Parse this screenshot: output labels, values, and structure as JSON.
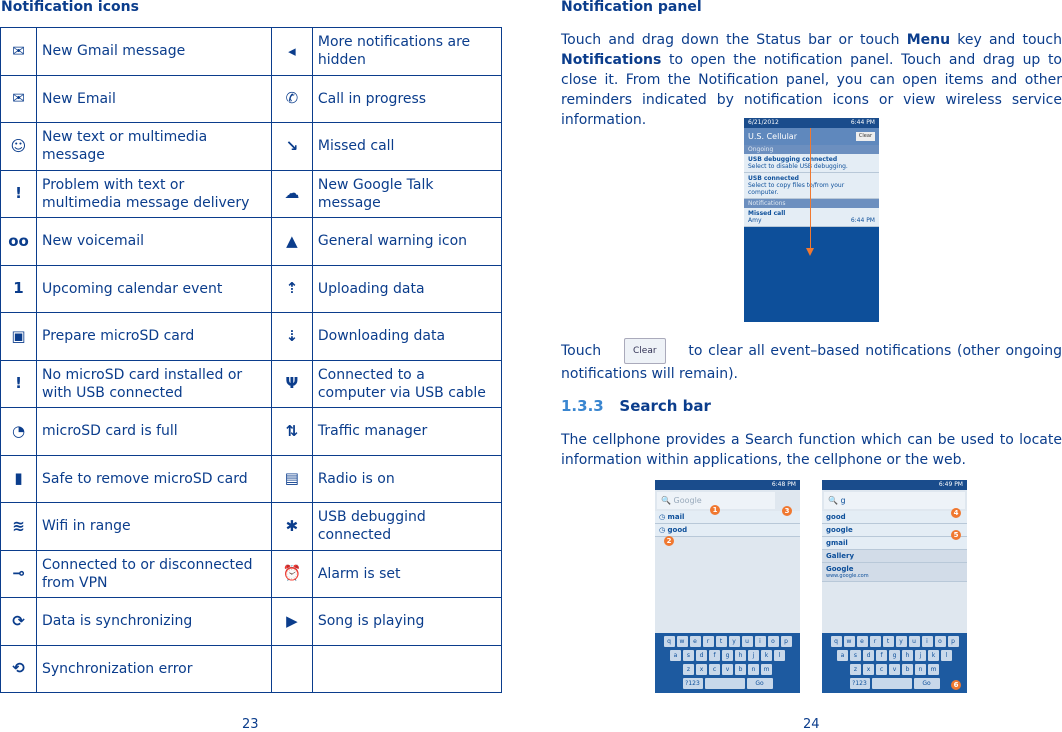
{
  "left": {
    "title": "Notification icons",
    "page": "23",
    "rows": [
      [
        "mail-icon",
        "New Gmail message",
        "hidden-notifications-icon",
        "More notifications are hidden"
      ],
      [
        "envelope-icon",
        "New Email",
        "phone-icon",
        "Call in progress"
      ],
      [
        "sms-icon",
        "New text or multimedia message",
        "missed-call-icon",
        "Missed call"
      ],
      [
        "sms-error-icon",
        "Problem with text or multimedia message delivery",
        "talk-icon",
        "New Google Talk message"
      ],
      [
        "voicemail-icon",
        "New voicemail",
        "warning-icon",
        "General warning icon"
      ],
      [
        "calendar-icon",
        "Upcoming calendar event",
        "upload-icon",
        "Uploading data"
      ],
      [
        "sd-prepare-icon",
        "Prepare microSD card",
        "download-icon",
        "Downloading data"
      ],
      [
        "sd-missing-icon",
        "No microSD card installed or with USB connected",
        "usb-icon",
        "Connected to a computer via USB cable"
      ],
      [
        "sd-full-icon",
        "microSD card is full",
        "traffic-icon",
        "Traffic manager"
      ],
      [
        "sd-remove-icon",
        "Safe to remove microSD card",
        "radio-icon",
        "Radio is on"
      ],
      [
        "wifi-icon",
        "Wifi in range",
        "bug-icon",
        "USB debuggind connected"
      ],
      [
        "vpn-icon",
        "Connected to or disconnected from VPN",
        "alarm-icon",
        "Alarm is set"
      ],
      [
        "sync-icon",
        "Data is synchronizing",
        "play-icon",
        "Song is playing"
      ],
      [
        "sync-error-icon",
        "Synchronization error",
        "",
        ""
      ]
    ]
  },
  "right": {
    "title": "Notification panel",
    "page": "24",
    "p1_a": "Touch and drag down the Status bar or touch ",
    "p1_menu": "Menu",
    "p1_b": " key and touch ",
    "p1_notif": "Notifications",
    "p1_c": " to open the notification panel. Touch and drag up to close it. From the Notification panel, you can open items and other reminders indicated by notification icons or view wireless service information.",
    "p2_a": "Touch",
    "clear": "Clear",
    "p2_b": "to clear all event–based notifications (other ongoing notifications will remain).",
    "sec_num": "1.3.3",
    "sec_title": "Search bar",
    "p3": "The cellphone provides a Search function which can be used to locate information within applications, the cellphone or the web.",
    "panel": {
      "date": "6/21/2012",
      "time": "6:44 PM",
      "carrier": "U.S. Cellular",
      "clear": "Clear",
      "ongoing": "Ongoing",
      "i1": "USB debugging connected",
      "i1s": "Select to disable USB debugging.",
      "i2": "USB connected",
      "i2s": "Select to copy files to/from your computer.",
      "notifications": "Notifications",
      "i3": "Missed call",
      "i3s": "Amy",
      "i3t": "6:44 PM"
    },
    "s1": {
      "time": "6:48 PM",
      "placeholder": "Google",
      "items": [
        "mail",
        "good"
      ],
      "badges": [
        "1",
        "2",
        "3"
      ]
    },
    "s2": {
      "time": "6:49 PM",
      "query": "g",
      "items": [
        "good",
        "google",
        "gmail"
      ],
      "gallery": "Gallery",
      "google": "Google",
      "url": "www.google.com",
      "badges": [
        "4",
        "5",
        "6"
      ]
    },
    "keys": {
      "r1": [
        "q",
        "w",
        "e",
        "r",
        "t",
        "y",
        "u",
        "i",
        "o",
        "p"
      ],
      "r2": [
        "a",
        "s",
        "d",
        "f",
        "g",
        "h",
        "j",
        "k",
        "l"
      ],
      "r3": [
        "z",
        "x",
        "c",
        "v",
        "b",
        "n",
        "m"
      ],
      "sym": "?123",
      "go": "Go"
    }
  },
  "colors": {
    "text": "#0b3d8c",
    "badge": "#f07830"
  }
}
